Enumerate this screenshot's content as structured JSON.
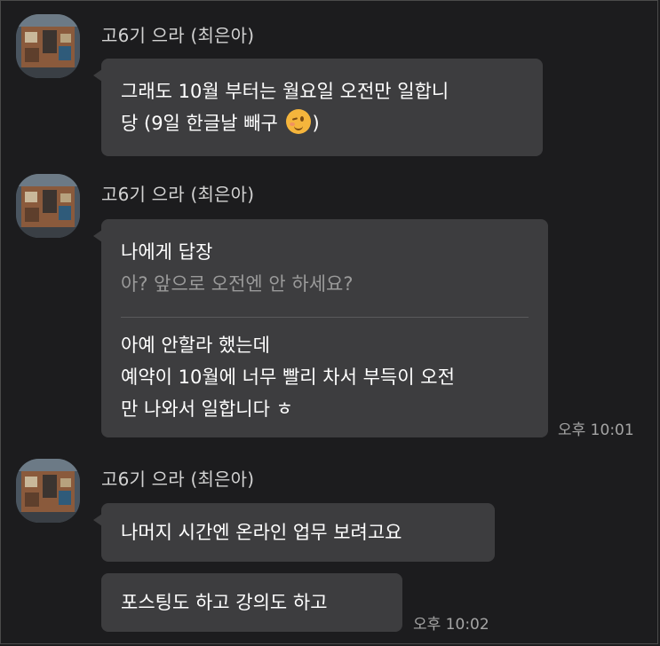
{
  "sender_name": "고6기 으라 (최은아)",
  "messages": [
    {
      "lines": [
        "그래도 10월 부터는 월요일 오전만 일합니",
        "당 (9일 한글날 빼구"
      ],
      "line2_suffix": ")",
      "emoji": "wink-face-icon"
    },
    {
      "reply_label": "나에게 답장",
      "reply_quote": "아? 앞으로 오전엔 안 하세요?",
      "lines": [
        "아예 안할라 했는데",
        "예약이 10월에 너무 빨리 차서 부득이 오전",
        "만 나와서 일합니다 ㅎ"
      ],
      "time": "오후 10:01"
    },
    {
      "lines": [
        "나머지 시간엔 온라인 업무 보려고요"
      ]
    },
    {
      "lines": [
        "포스팅도 하고 강의도 하고"
      ],
      "time": "오후 10:02"
    }
  ],
  "colors": {
    "background": "#1c1c1e",
    "bubble": "#3d3d3f",
    "sender": "#d2d2d2",
    "timestamp": "#a5a5a5",
    "quote": "#9a9a9a"
  }
}
